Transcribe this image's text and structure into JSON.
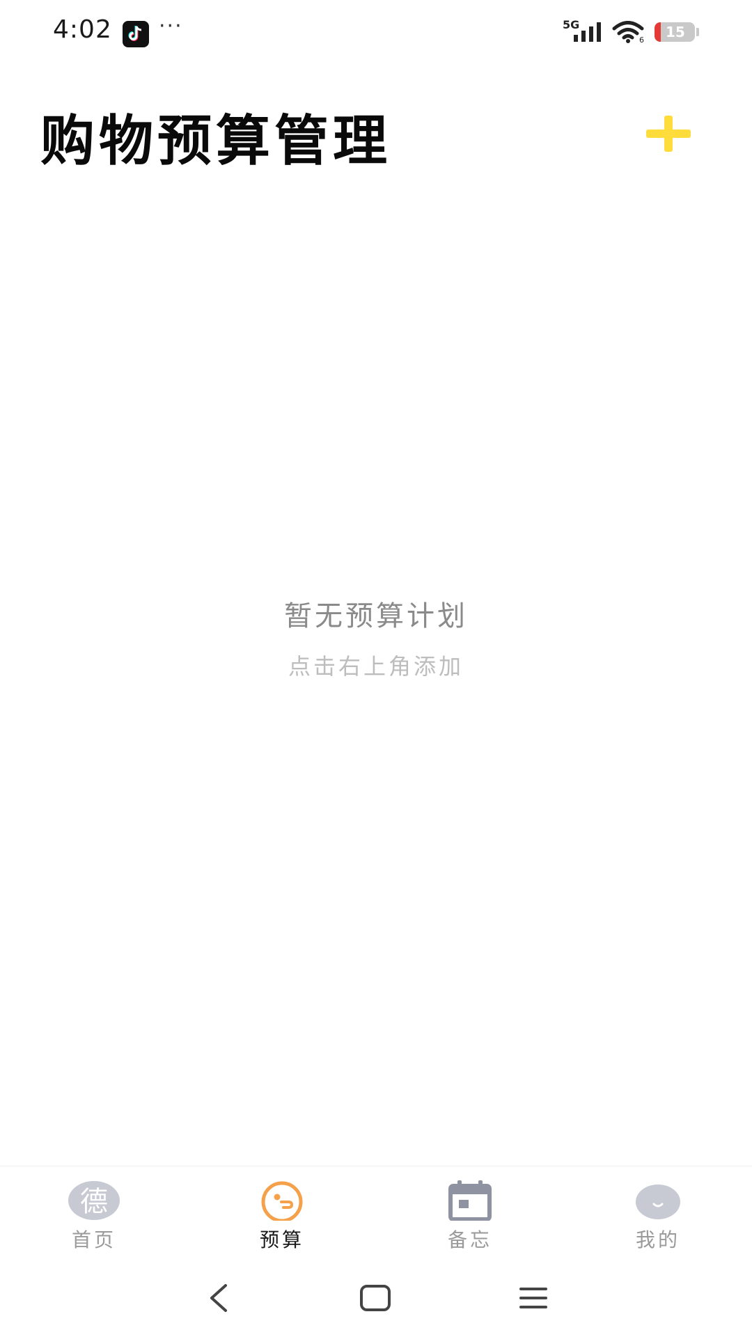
{
  "status_bar": {
    "time": "4:02",
    "more": "···",
    "network": "5G",
    "battery_level": "15",
    "battery_fraction": 0.15,
    "battery_low_color": "#e53935"
  },
  "header": {
    "title": "购物预算管理",
    "add_icon": "plus-icon",
    "accent_color": "#fddc3b"
  },
  "empty_state": {
    "title": "暂无预算计划",
    "hint": "点击右上角添加"
  },
  "tab_bar": {
    "tabs": [
      {
        "label": "首页",
        "icon": "home-de-icon",
        "active": false
      },
      {
        "label": "预算",
        "icon": "budget-icon",
        "active": true
      },
      {
        "label": "备忘",
        "icon": "calendar-icon",
        "active": false
      },
      {
        "label": "我的",
        "icon": "profile-icon",
        "active": false
      }
    ],
    "active_color": "#f5a04a",
    "inactive_icon_color": "#c7c9d3"
  },
  "nav_bar": {
    "back_icon": "back-chevron-icon",
    "home_icon": "home-square-icon",
    "menu_icon": "menu-lines-icon"
  }
}
